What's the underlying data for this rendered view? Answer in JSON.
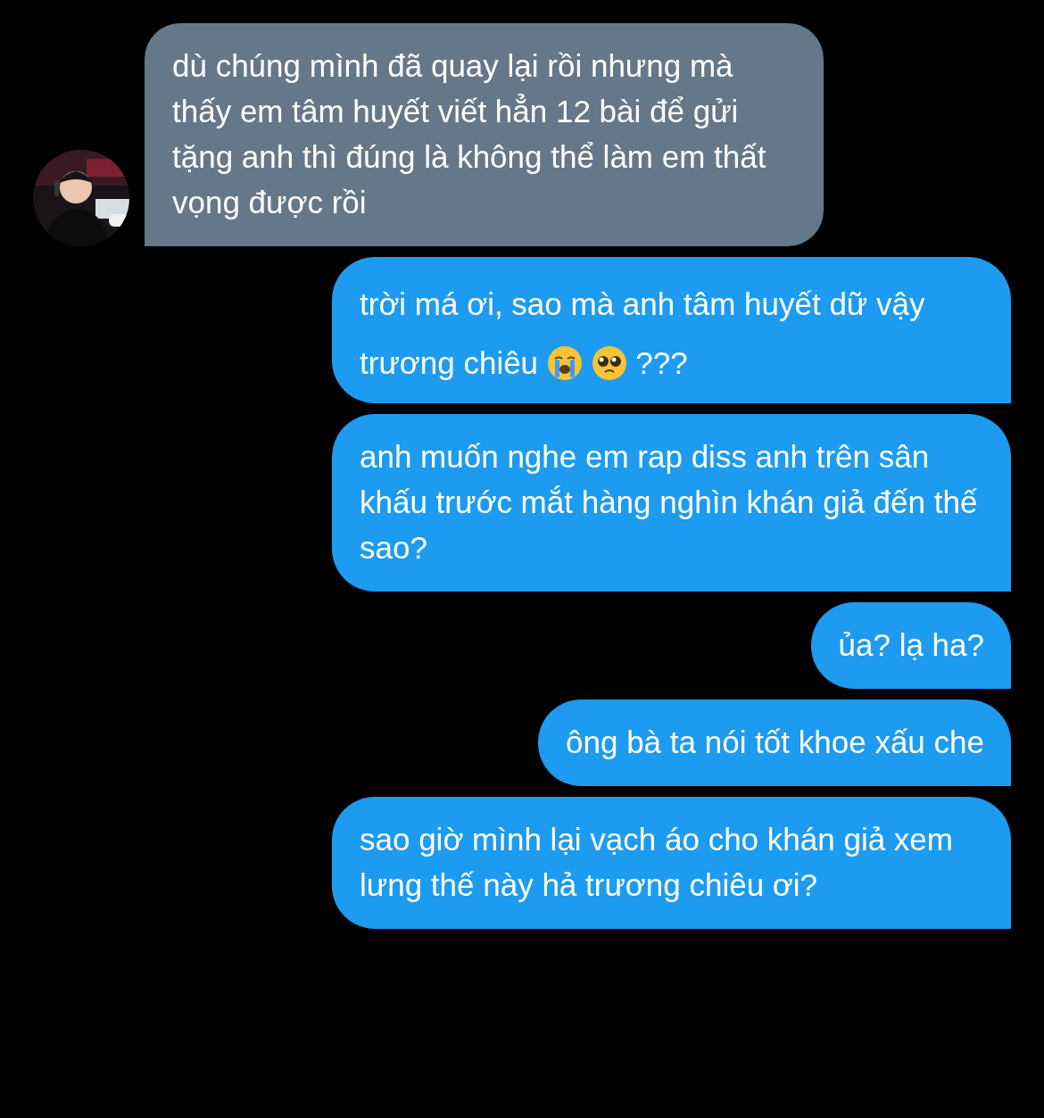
{
  "messages": [
    {
      "kind": "received",
      "parts": [
        {
          "kind": "text",
          "text": "dù chúng mình đã quay lại rồi nhưng mà thấy em tâm huyết viết hẳn 12 bài để gửi tặng anh thì đúng là không thể làm em thất vọng được rồi"
        }
      ]
    },
    {
      "kind": "sent",
      "parts": [
        {
          "kind": "text",
          "text": "trời má ơi, sao mà anh tâm huyết dữ vậy trương chiêu"
        },
        {
          "kind": "crying-face"
        },
        {
          "kind": "pleading-face"
        },
        {
          "kind": "text",
          "text": "???"
        }
      ]
    },
    {
      "kind": "sent",
      "parts": [
        {
          "kind": "text",
          "text": "anh muốn nghe em rap diss anh trên sân khấu trước mắt hàng nghìn khán giả đến thế sao?"
        }
      ]
    },
    {
      "kind": "sent",
      "parts": [
        {
          "kind": "text",
          "text": "ủa? lạ ha?"
        }
      ]
    },
    {
      "kind": "sent",
      "parts": [
        {
          "kind": "text",
          "text": "ông bà ta nói tốt khoe xấu che"
        }
      ]
    },
    {
      "kind": "sent",
      "parts": [
        {
          "kind": "text",
          "text": "sao giờ mình lại vạch áo cho khán giả xem lưng thế này hả trương chiêu ơi?"
        }
      ]
    }
  ]
}
